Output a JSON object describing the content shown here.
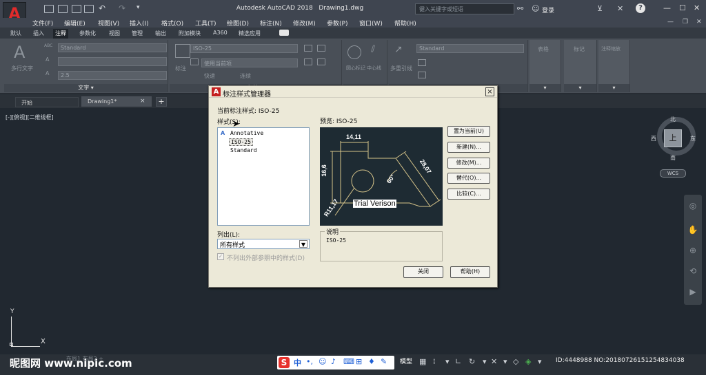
{
  "title": {
    "app": "Autodesk AutoCAD 2018",
    "file": "Drawing1.dwg",
    "search_placeholder": "键入关键字或短语",
    "login": "登录",
    "logo_letter": "A"
  },
  "menu": [
    "文件(F)",
    "编辑(E)",
    "视图(V)",
    "插入(I)",
    "格式(O)",
    "工具(T)",
    "绘图(D)",
    "标注(N)",
    "修改(M)",
    "参数(P)",
    "窗口(W)",
    "帮助(H)"
  ],
  "ribbon_tabs": [
    {
      "label": "默认",
      "active": false
    },
    {
      "label": "插入",
      "active": false
    },
    {
      "label": "注释",
      "active": true
    },
    {
      "label": "参数化",
      "active": false
    },
    {
      "label": "视图",
      "active": false
    },
    {
      "label": "管理",
      "active": false
    },
    {
      "label": "输出",
      "active": false
    },
    {
      "label": "附加模块",
      "active": false
    },
    {
      "label": "A360",
      "active": false
    },
    {
      "label": "精选应用",
      "active": false
    }
  ],
  "ribbon": {
    "text_panel": {
      "big_icon_letter": "A",
      "big_label": "多行文字",
      "abc": "ABC",
      "style_value": "Standard",
      "height_value": "2.5",
      "footer": "文字 ▾"
    },
    "dim_panel": {
      "big_label": "标注",
      "style_value": "ISO-25",
      "layer_value": "使用当前项",
      "quick": "快速",
      "continue": "连续",
      "footer": "标注 ▾"
    },
    "mark_panel": {
      "center": "圆心标记",
      "centerline": "中心线"
    },
    "leader_panel": {
      "big_label": "多重引线",
      "style_value": "Standard"
    },
    "tables": "表格",
    "markup": "标记",
    "annot_scale": "注释缩放"
  },
  "file_tabs": {
    "start": "开始",
    "drawing": "Drawing1*",
    "close": "×",
    "add": "+"
  },
  "canvas": {
    "view_label": "[-][俯视][二维线框]",
    "axis_y": "Y",
    "axis_x": "X"
  },
  "viewcube": {
    "north": "北",
    "south": "南",
    "east": "东",
    "west": "西",
    "face": "上",
    "wcs": "WCS"
  },
  "status": {
    "model": "模型",
    "watermark": "昵图网 www.nipic.com",
    "id_text": "ID:4448988 NO:20180726151254834038",
    "layout_tabs": "布局1   布局2  +"
  },
  "ime": {
    "cn": "中",
    "punct": "•,"
  },
  "dialog": {
    "title": "标注样式管理器",
    "title_icon": "A",
    "close": "×",
    "current_style_label": "当前标注样式: ISO-25",
    "styles_label": "样式(S):",
    "styles": [
      {
        "name": "Annotative",
        "icon": "A",
        "selected": false
      },
      {
        "name": "ISO-25",
        "icon": "",
        "selected": true
      },
      {
        "name": "Standard",
        "icon": "",
        "selected": false
      }
    ],
    "preview_label": "预览: ISO-25",
    "preview": {
      "dim_top": "14,11",
      "dim_left": "16,6",
      "dim_right": "28,07",
      "angle": "60°",
      "radius": "R11,17",
      "trial": "Trial Verison"
    },
    "list_label": "列出(L):",
    "list_value": "所有样式",
    "checkbox_label": "不列出外部参照中的样式(D)",
    "checkbox_checked": true,
    "desc_label": "说明",
    "desc_value": "ISO-25",
    "buttons": {
      "set_current": "置为当前(U)",
      "new": "新建(N)...",
      "modify": "修改(M)...",
      "override": "替代(O)...",
      "compare": "比较(C)...",
      "close": "关闭",
      "help": "帮助(H)"
    }
  },
  "colors": {
    "accent_red": "#c42020",
    "canvas": "#212830",
    "dialog": "#ece9d8",
    "preview_line": "#d6c48a"
  }
}
